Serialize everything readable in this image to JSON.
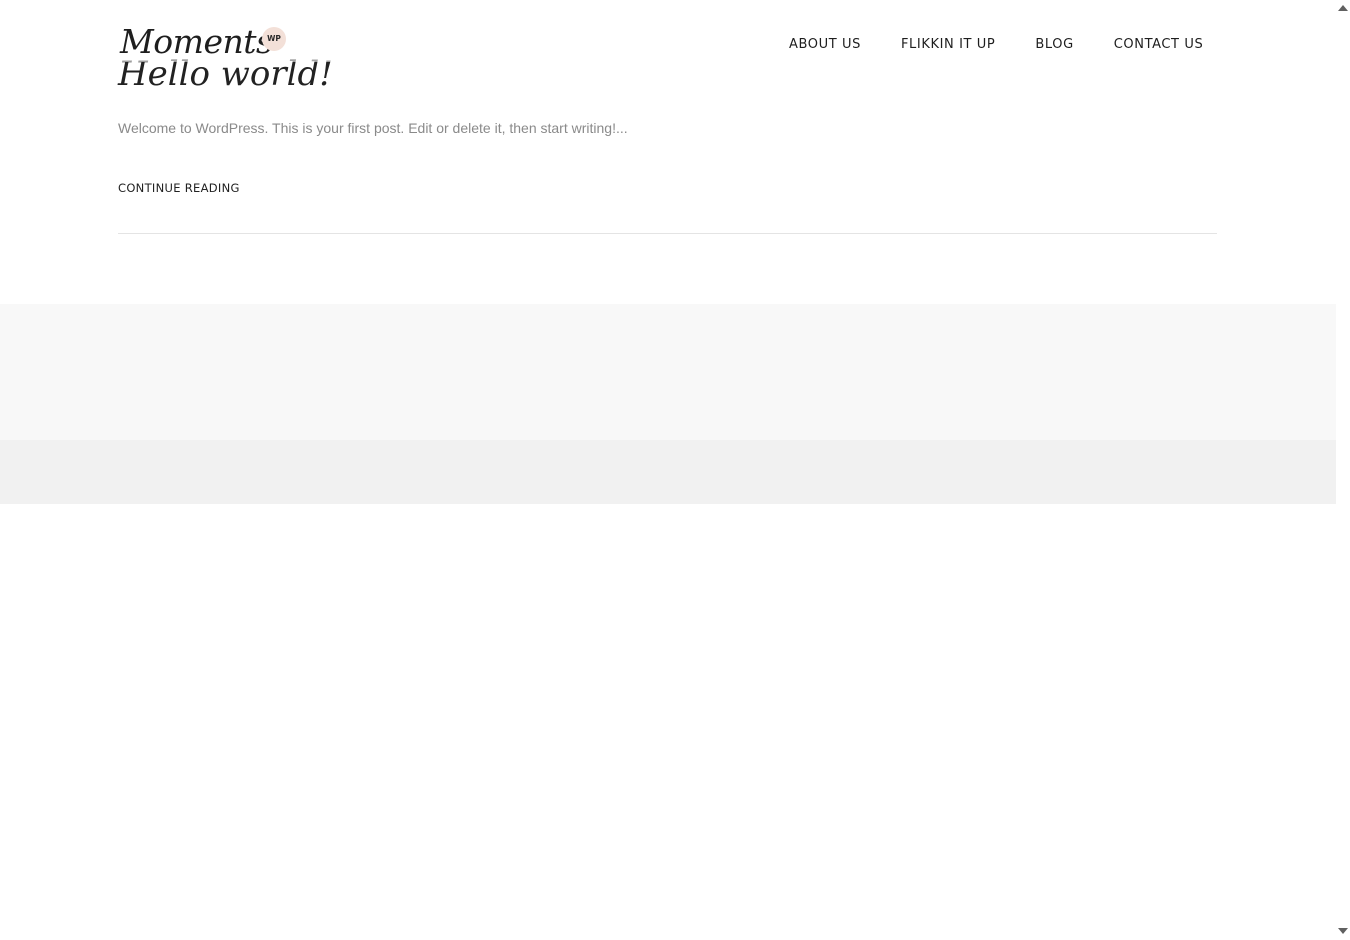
{
  "header": {
    "logo_text": "Moments",
    "logo_badge": "WP",
    "nav": [
      "ABOUT US",
      "FLIKKIN IT UP",
      "BLOG",
      "CONTACT US"
    ]
  },
  "post": {
    "title": "Hello world!",
    "excerpt": "Welcome to WordPress. This is your first post. Edit or delete it, then start writing!...",
    "continue_label": "CONTINUE READING"
  },
  "colors": {
    "text_dark": "#1e1e1e",
    "text_muted": "#8a8a8a",
    "badge_bg": "#f3e0d8",
    "footer_light": "#f8f8f8",
    "footer_dark": "#f1f1f1"
  },
  "icons": {
    "scroll_up": "scroll-up-arrow-icon",
    "scroll_down": "scroll-down-arrow-icon"
  }
}
